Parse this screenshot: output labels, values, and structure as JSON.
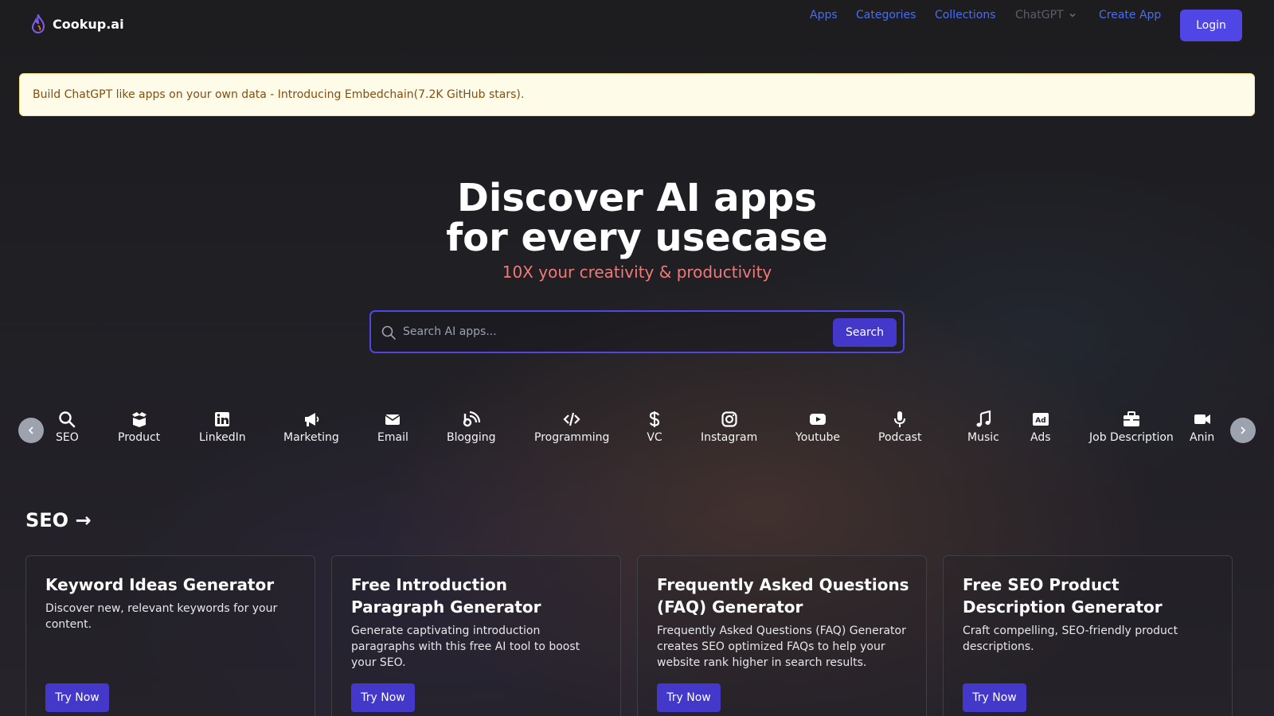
{
  "brand": {
    "name": "Cookup.ai",
    "logo_icon": "flame-icon"
  },
  "nav": {
    "items": [
      "Apps",
      "Categories",
      "Collections",
      "ChatGPT",
      "Create App"
    ],
    "login": "Login"
  },
  "banner": {
    "text": "Build ChatGPT like apps on your own data - Introducing Embedchain(7.2K GitHub stars)."
  },
  "hero": {
    "title_line1": "Discover AI apps",
    "title_line2": "for every usecase",
    "subtitle": "10X your creativity & productivity"
  },
  "search": {
    "placeholder": "Search AI apps...",
    "button": "Search"
  },
  "categories": [
    {
      "label": "SEO",
      "icon": "search-icon"
    },
    {
      "label": "Product",
      "icon": "box-icon"
    },
    {
      "label": "LinkedIn",
      "icon": "linkedin-icon"
    },
    {
      "label": "Marketing",
      "icon": "megaphone-icon"
    },
    {
      "label": "Email",
      "icon": "envelope-icon"
    },
    {
      "label": "Blogging",
      "icon": "blog-icon"
    },
    {
      "label": "Programming",
      "icon": "code-icon"
    },
    {
      "label": "VC",
      "icon": "dollar-icon"
    },
    {
      "label": "Instagram",
      "icon": "instagram-icon"
    },
    {
      "label": "Youtube",
      "icon": "youtube-icon"
    },
    {
      "label": "Podcast",
      "icon": "microphone-icon"
    },
    {
      "label": "Music",
      "icon": "music-note-icon"
    },
    {
      "label": "Ads",
      "icon": "ad-icon"
    },
    {
      "label": "Job Description",
      "icon": "briefcase-icon"
    },
    {
      "label": "Anin",
      "icon": "video-camera-icon"
    }
  ],
  "section": {
    "title": "SEO →",
    "cards": [
      {
        "title": "Keyword Ideas Generator",
        "description": "Discover new, relevant keywords for your content.",
        "button": "Try Now"
      },
      {
        "title": "Free Introduction Paragraph Generator",
        "description": "Generate captivating introduction paragraphs with this free AI tool to boost your SEO.",
        "button": "Try Now"
      },
      {
        "title": "Frequently Asked Questions (FAQ) Generator",
        "description": "Frequently Asked Questions (FAQ) Generator creates SEO optimized FAQs to help your website rank higher in search results.",
        "button": "Try Now"
      },
      {
        "title": "Free SEO Product Description Generator",
        "description": "Craft compelling, SEO-friendly product descriptions.",
        "button": "Try Now"
      }
    ]
  },
  "colors": {
    "accent": "#4f46e5",
    "nav_link": "#4a6cf0",
    "subtitle": "#f07a7a",
    "banner_bg": "#fefce8",
    "banner_text": "#854d0e"
  }
}
